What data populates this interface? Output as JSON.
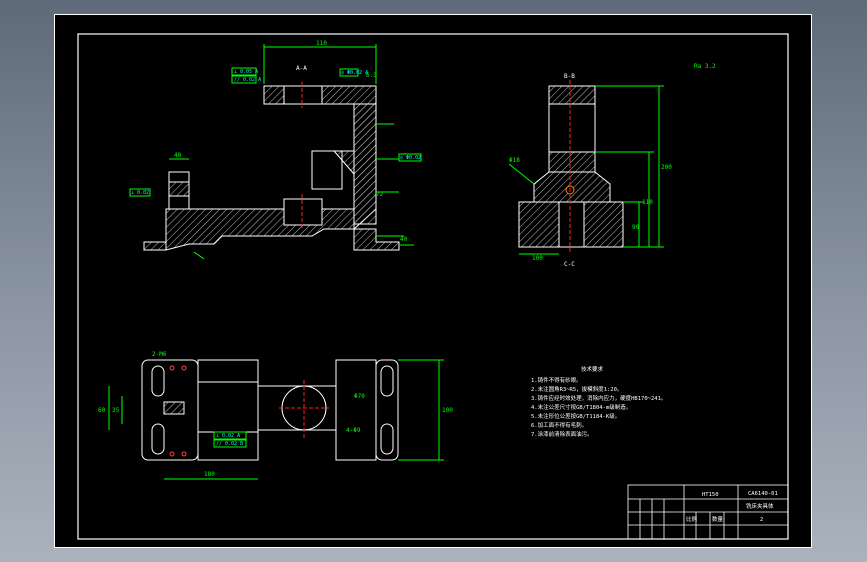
{
  "drawing": {
    "front_view": {
      "dims": {
        "top_width": "110",
        "left_lug": "40",
        "right_angle": "72",
        "right_height": "40"
      },
      "callouts": {
        "pos_1": "1",
        "pos_2": "2",
        "bottom_1": "35",
        "bottom_2": "35"
      },
      "tol_boxes": [
        "⊥ 0.05 A",
        "// 0.02 A",
        "◎ Φ0.02 A",
        "◎ Φ0.02",
        "⊥ 0.02"
      ],
      "section_mark": "A-A",
      "roughness": "Ra 3.2"
    },
    "side_view": {
      "section_top": "B-B",
      "section_bottom": "C-C",
      "dims": {
        "height_total": "200",
        "height_mid": "110",
        "height_low": "90",
        "base": "100",
        "diameter": "Φ18"
      }
    },
    "plan_view": {
      "dims": {
        "width_left": "60",
        "width_mid": "35",
        "height_right": "100",
        "length": "180",
        "hole_note": "4xΦ9",
        "bore": "Φ70"
      },
      "labels": {
        "top_left": "2-M6",
        "slot": "4-Φ9"
      },
      "tol_boxes": [
        "⊥ 0.02 A",
        "// 0.02 B"
      ]
    },
    "tech_requirements": {
      "title": "技术要求",
      "items": [
        "1.铸件不得有砂眼。",
        "2.未注圆角R3~R5，拔模斜度1:20。",
        "3.铸件应经时效处理，消除内应力，硬度HB170~241。",
        "4.未注公差尺寸按GB/T1804-m级制造。",
        "5.未注形位公差按GB/T1184-K级。",
        "6.加工面不得有毛刺。",
        "7.涂漆前清除表面油污。"
      ]
    },
    "title_block": {
      "part_name": "铣床夹具体",
      "material": "HT150",
      "sheet": "2",
      "drawing_no": "CA6140-01",
      "scale_label": "比例",
      "qty_label": "数量"
    },
    "surface_finish": "6.3"
  },
  "colors": {
    "sheet": "#000000",
    "line": "#ffffff",
    "dim": "#00ff00",
    "hatch": "#c0c0c0",
    "center": "#ff2020",
    "tol": "#00ffff"
  }
}
